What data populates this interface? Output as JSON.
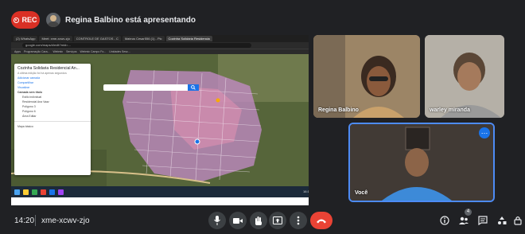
{
  "recording": {
    "label": "REC"
  },
  "presentation": {
    "banner": "Regina Balbino está apresentando"
  },
  "shared_screen": {
    "tabs": [
      "(2) WhatsApp",
      "Meet: xme-xcwv-zjo",
      "CONTROLE DE GASTOS - C",
      "Mateus Cesar556 (1) - Pic",
      "Cozinha Solidária Residencia"
    ],
    "url": "google.com/maps/d/edit?mid=...",
    "bookmarks": [
      "Apps",
      "Programação Cara...",
      "Webmix",
      "Serviços",
      "Webmix Campo Fo...",
      "Unidades Sesc..."
    ],
    "map_panel": {
      "title": "Cozinha Solidaria Residencial An...",
      "subtitle": "A última edição foi há apenas segundos",
      "actions": [
        "Adicionar camada",
        "Compartilhar",
        "Visualizar"
      ],
      "layer": "Camada sem título",
      "layer_items": [
        "Estilo individual",
        "Residencial Ana Vaaz",
        "Polígono 3",
        "Polígono 6",
        "Área Editar"
      ],
      "base": "Mapa básico"
    },
    "taskbar_time": "16:10"
  },
  "participants": [
    {
      "name": "Regina Balbino"
    },
    {
      "name": "warley miranda"
    },
    {
      "name": "Você"
    }
  ],
  "bottom_bar": {
    "time": "14:20",
    "meeting_code": "xme-xcwv-zjo",
    "participants_count": "4"
  },
  "colors": {
    "end_call": "#ea4335",
    "rec": "#d93025",
    "self_border": "#4d8bf5"
  }
}
